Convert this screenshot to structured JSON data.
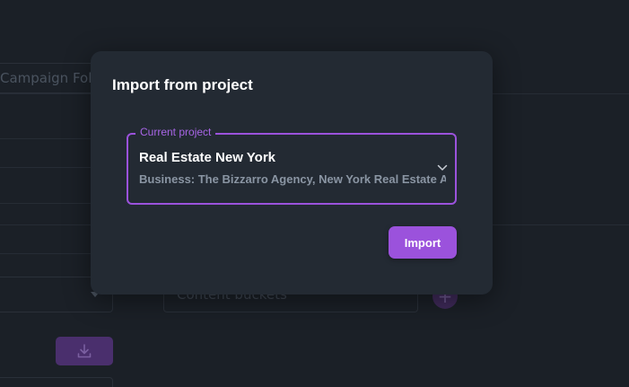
{
  "background": {
    "folder_label": "Campaign Folders",
    "content_select_placeholder": "Content buckets",
    "plus_label": "+"
  },
  "dialog": {
    "title": "Import from project",
    "field": {
      "legend": "Current project",
      "value": "Real Estate New York",
      "subtext": "Business: The Bizzarro Agency, New York Real Estate Agency",
      "icon": "chevron-down-icon"
    },
    "import_label": "Import"
  },
  "colors": {
    "accent": "#9b52dc",
    "dialog_bg": "#232a33",
    "page_bg": "#1b2027"
  }
}
